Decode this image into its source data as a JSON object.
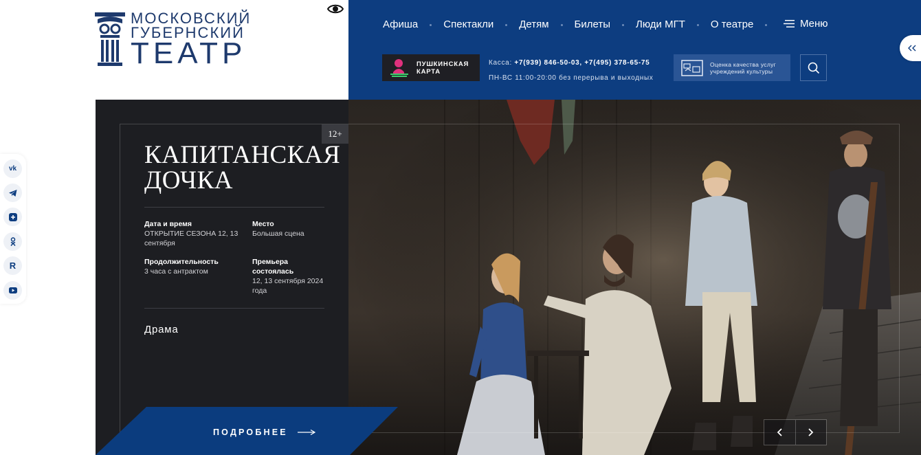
{
  "logo": {
    "line1": "МОСКОВСКИЙ",
    "line2": "ГУБЕРНСКИЙ",
    "line3": "ТЕАТР"
  },
  "nav": {
    "items": [
      {
        "label": "Афиша"
      },
      {
        "label": "Спектакли"
      },
      {
        "label": "Детям"
      },
      {
        "label": "Билеты"
      },
      {
        "label": "Люди МГТ"
      },
      {
        "label": "О театре"
      }
    ],
    "menu_label": "Меню"
  },
  "pushkin_card": {
    "label": "ПУШКИНСКАЯ КАРТА"
  },
  "box_office": {
    "prefix": "Касса:",
    "phones": "+7(939) 846-50-03, +7(495) 378-65-75",
    "hours": "ПН-ВС 11:00-20:00 без перерыва и выходных"
  },
  "quality": {
    "label_line1": "Оценка качества услуг",
    "label_line2": "учреждений культуры"
  },
  "social": [
    "vk-icon",
    "telegram-icon",
    "plus-icon",
    "odnoklassniki-icon",
    "rutube-icon",
    "youtube-icon"
  ],
  "hero": {
    "age_rating": "12+",
    "title_line1": "КАПИТАНСКАЯ",
    "title_line2": "ДОЧКА",
    "date_label": "Дата и время",
    "date_value": "ОТКРЫТИЕ СЕЗОНА 12, 13 сентября",
    "place_label": "Место",
    "place_value": "Большая сцена",
    "duration_label": "Продолжительность",
    "duration_value": "3 часа с антрактом",
    "premiere_label": "Премьера состоялась",
    "premiere_value": "12, 13 сентября 2024 года",
    "genre": "Драма",
    "more_label": "ПОДРОБНЕЕ"
  },
  "colors": {
    "brand_blue": "#0d3d80",
    "dark_panel": "#1d1e22",
    "accent_blue": "#0b3c7e"
  }
}
